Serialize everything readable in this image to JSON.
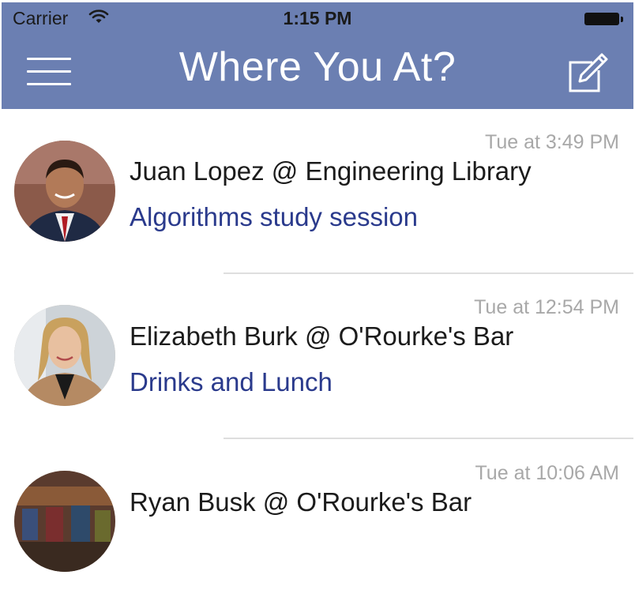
{
  "status_bar": {
    "carrier": "Carrier",
    "time": "1:15 PM",
    "wifi_icon": "wifi-icon",
    "battery_icon": "battery-icon"
  },
  "nav_bar": {
    "title": "Where You At?",
    "menu_icon": "hamburger-menu-icon",
    "compose_icon": "compose-icon",
    "background_color": "#6b7fb2"
  },
  "feed": {
    "items": [
      {
        "name_location": "Juan Lopez @ Engineering Library",
        "note": "Algorithms study session",
        "time": "Tue at 3:49 PM",
        "avatar": "Juan Lopez avatar"
      },
      {
        "name_location": "Elizabeth Burk @ O'Rourke's Bar",
        "note": "Drinks and Lunch",
        "time": "Tue at 12:54 PM",
        "avatar": "Elizabeth Burk avatar"
      },
      {
        "name_location": "Ryan Busk @ O'Rourke's Bar",
        "note": "",
        "time": "Tue at 10:06 AM",
        "avatar": "Ryan Busk avatar"
      }
    ],
    "note_color": "#2a3a8c",
    "time_color": "#a8a8a8"
  }
}
